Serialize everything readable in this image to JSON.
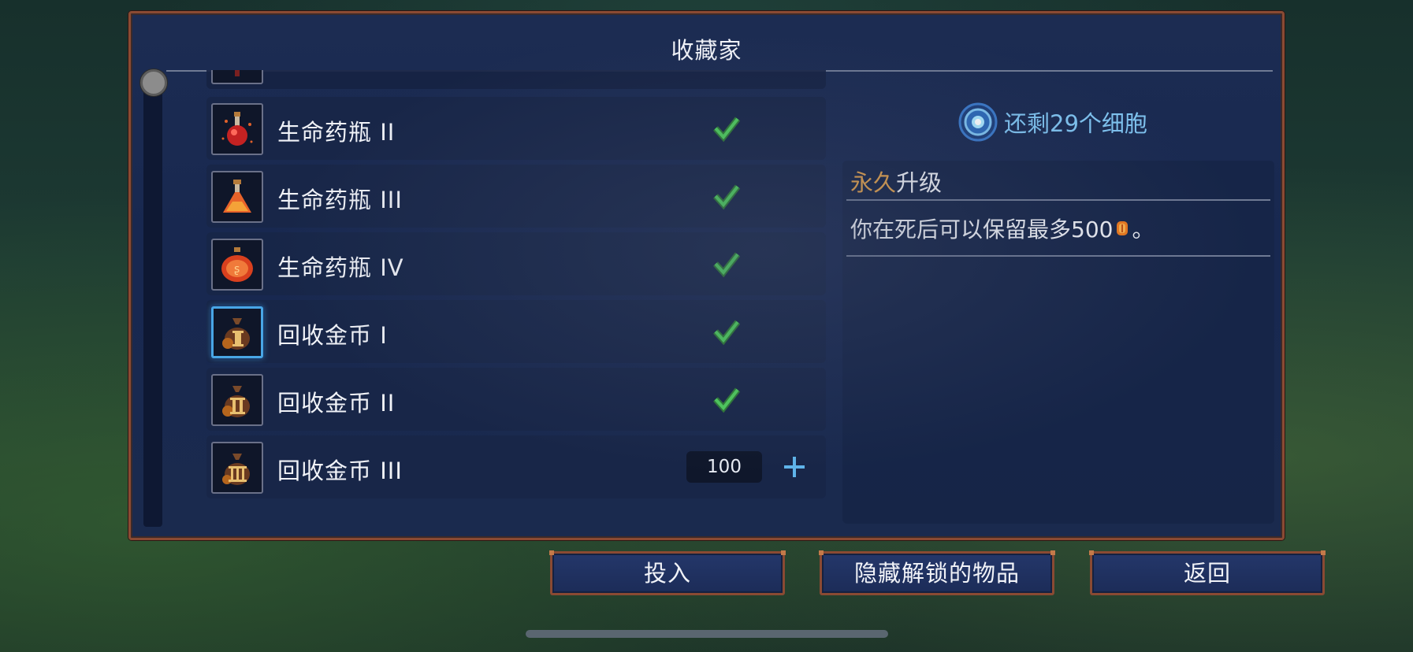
{
  "window": {
    "title": "收藏家"
  },
  "items": [
    {
      "label": "生命药瓶 II",
      "icon": "red-potion-flask-icon",
      "status": "unlocked"
    },
    {
      "label": "生命药瓶 III",
      "icon": "orange-potion-flask-icon",
      "status": "unlocked"
    },
    {
      "label": "生命药瓶 IV",
      "icon": "round-potion-flask-icon",
      "status": "unlocked"
    },
    {
      "label": "回收金币 I",
      "icon": "gold-bag-i-icon",
      "status": "unlocked",
      "selected": true
    },
    {
      "label": "回收金币 II",
      "icon": "gold-bag-ii-icon",
      "status": "unlocked"
    },
    {
      "label": "回收金币 III",
      "icon": "gold-bag-iii-icon",
      "status": "locked",
      "cost": "100"
    }
  ],
  "cells": {
    "remaining_text": "还剩29个细胞",
    "icon": "cell-icon"
  },
  "description": {
    "category_prefix": "永久",
    "category_suffix": "升级",
    "text_before": "你在死后可以保留最多500",
    "text_after": "。",
    "inline_icon": "gold-coin-icon"
  },
  "buttons": {
    "invest": "投入",
    "hide_unlocked": "隐藏解锁的物品",
    "back": "返回"
  },
  "colors": {
    "accent_orange": "#e3a24c",
    "cells_blue": "#7fc3f0",
    "check_green": "#3fbf4f",
    "selected_border": "#49a6e6",
    "frame_copper": "#8a4a33"
  }
}
